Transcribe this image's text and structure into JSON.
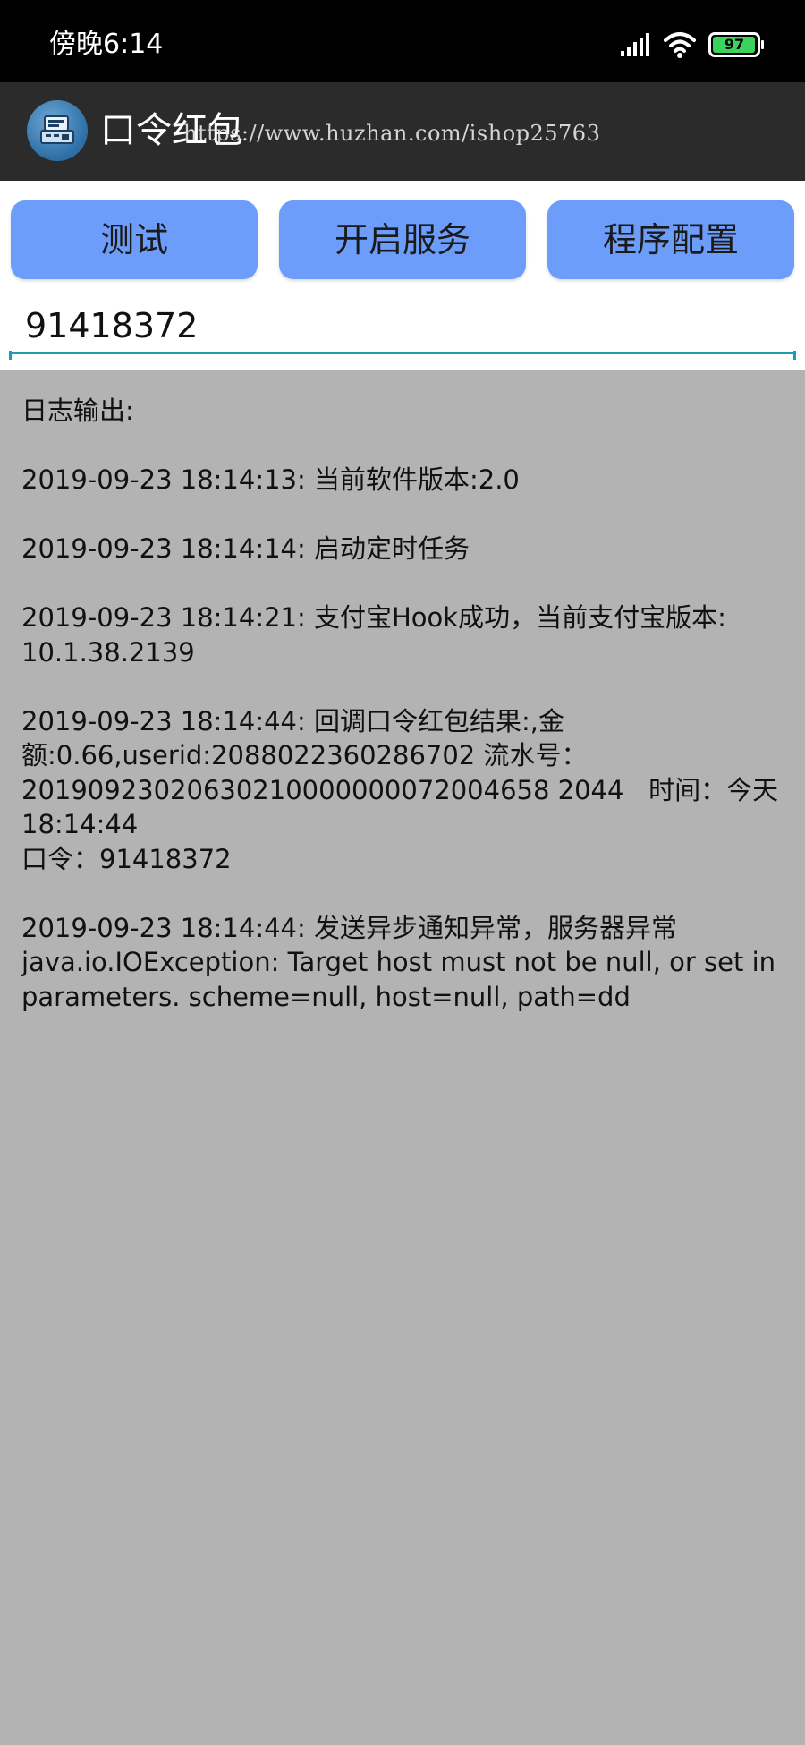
{
  "status_bar": {
    "time": "傍晚6:14",
    "battery": "97",
    "battery_color": "#3bd35b"
  },
  "app_bar": {
    "title": "口令红包",
    "watermark": "https://www.huzhan.com/ishop25763",
    "icon": "app-icon"
  },
  "toolbar": {
    "test_label": "测试",
    "start_service_label": "开启服务",
    "config_label": "程序配置",
    "button_color": "#6d9dfb"
  },
  "code_input": {
    "value": "91418372"
  },
  "log": {
    "header": "日志输出:",
    "entries": [
      {
        "lines": [
          "2019-09-23 18:14:13: 当前软件版本:2.0"
        ]
      },
      {
        "lines": [
          "2019-09-23 18:14:14: 启动定时任务"
        ]
      },
      {
        "lines": [
          "2019-09-23 18:14:21: 支付宝Hook成功，当前支付宝版本:",
          "10.1.38.2139"
        ]
      },
      {
        "lines": [
          "2019-09-23 18:14:44: 回调口令红包结果:,金",
          "额:0.66,userid:2088022360286702 流水号：",
          "20190923020630210000000072004658 2044   时间：今天",
          "18:14:44",
          "口令：91418372"
        ]
      },
      {
        "lines": [
          "2019-09-23 18:14:44: 发送异步通知异常，服务器异常",
          "java.io.IOException: Target host must not be null, or set in",
          "parameters. scheme=null, host=null, path=dd"
        ]
      }
    ]
  }
}
